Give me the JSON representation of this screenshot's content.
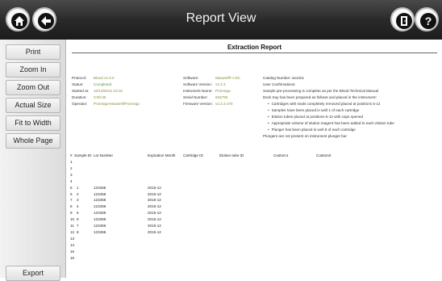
{
  "header": {
    "title": "Report View",
    "icons": [
      "home-icon",
      "back-icon",
      "exit-door-icon",
      "help-icon"
    ]
  },
  "sidebar": {
    "buttons": [
      "Print",
      "Zoom In",
      "Zoom Out",
      "Actual Size",
      "Fit to Width",
      "Whole Page"
    ],
    "export": "Export"
  },
  "report": {
    "title": "Extraction Report",
    "left_meta": [
      {
        "key": "Protocol:",
        "value": "Blood v1.0.0"
      },
      {
        "key": "Status:",
        "value": "Completed"
      },
      {
        "key": "Started at:",
        "value": "10/13/2014 10:16"
      },
      {
        "key": "Duration:",
        "value": "0:00:30"
      },
      {
        "key": "Operator:",
        "value": "Promega-Maxwell\\Promega"
      }
    ],
    "mid_meta": [
      {
        "key": "Software:",
        "value": "Maxwell® CSC"
      },
      {
        "key": "Software Version:",
        "value": "v2.2.3"
      },
      {
        "key": "Instrument Name:",
        "value": "Promega"
      },
      {
        "key": "Serial Number:",
        "value": "634790"
      },
      {
        "key": "Firmware Version:",
        "value": "v2.2.3.470"
      }
    ],
    "right_meta": {
      "catalog": "Catalog Number: as1321",
      "confirm_title": "User Confirmations:",
      "line1": "Sample pre-processing is complete as per the Blood Technical Manual",
      "line2": "Deck tray has been prepared as follows and placed in the instrument:",
      "bullets": [
        "Cartridges with seals completely removed placed at positions 5-12",
        "Samples have been placed in well 1 of each cartridge",
        "Elution tubes placed at positions 5-12 with caps opened",
        "Appropriate volume of elution reagent has been added to each elution tube",
        "Plunger has been placed in well 8 of each cartridge"
      ],
      "footer": "Plungers are not present on instrument plunger bar"
    },
    "table": {
      "headers": [
        "#",
        "Sample ID",
        "Lot Number",
        "Expiration Month",
        "Cartridge ID",
        "Elution tube ID",
        "Custom1",
        "Custom2"
      ],
      "rows": [
        [
          "1",
          "",
          "",
          ""
        ],
        [
          "2",
          "",
          "",
          ""
        ],
        [
          "3",
          "",
          "",
          ""
        ],
        [
          "4",
          "",
          "",
          ""
        ],
        [
          "5",
          "1",
          "123456",
          "2015-12"
        ],
        [
          "6",
          "2",
          "123456",
          "2015-12"
        ],
        [
          "7",
          "3",
          "123456",
          "2015-12"
        ],
        [
          "8",
          "4",
          "123456",
          "2015-12"
        ],
        [
          "9",
          "5",
          "123456",
          "2015-12"
        ],
        [
          "10",
          "6",
          "123456",
          "2015-12"
        ],
        [
          "11",
          "7",
          "123456",
          "2015-12"
        ],
        [
          "12",
          "8",
          "123456",
          "2015-12"
        ],
        [
          "13",
          "",
          "",
          ""
        ],
        [
          "14",
          "",
          "",
          ""
        ],
        [
          "15",
          "",
          "",
          ""
        ],
        [
          "16",
          "",
          "",
          ""
        ]
      ]
    }
  }
}
